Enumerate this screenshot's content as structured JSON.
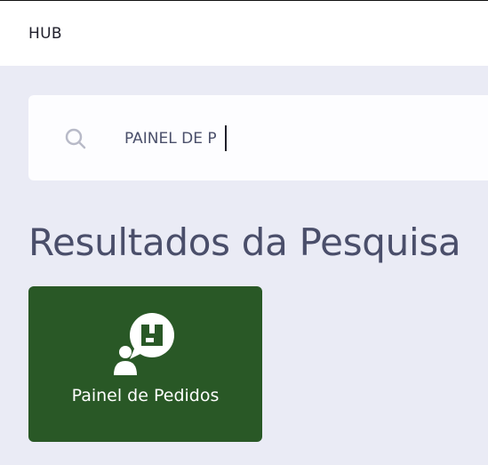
{
  "header": {
    "app_title": "HUB"
  },
  "search": {
    "value": "PAINEL DE P",
    "icon": "search-icon"
  },
  "results": {
    "heading": "Resultados da Pesquisa",
    "items": [
      {
        "label": "Painel de Pedidos",
        "icon": "person-package-bubble-icon",
        "background_color": "#295826"
      }
    ]
  },
  "colors": {
    "page_background": "#eaebf5",
    "card_green": "#295826",
    "heading_text": "#4a4e6a"
  }
}
